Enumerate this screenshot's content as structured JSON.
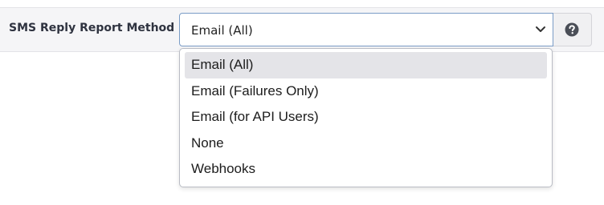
{
  "field": {
    "label": "SMS Reply Report Method",
    "selected_value": "Email (All)"
  },
  "help": {
    "icon": "question-circle-icon"
  },
  "dropdown": {
    "selected_index": 0,
    "options": [
      "Email (All)",
      "Email (Failures Only)",
      "Email (for API Users)",
      "None",
      "Webhooks"
    ]
  },
  "colors": {
    "row_background": "#f5f5f7",
    "select_border_focus": "#7a9cc6",
    "option_highlight": "#e4e4e8",
    "help_icon": "#4a4e57"
  }
}
